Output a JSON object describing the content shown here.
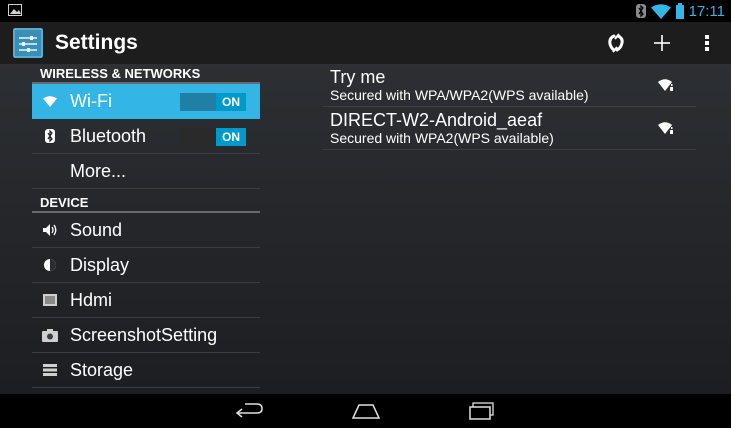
{
  "status_bar": {
    "time": "17:11",
    "icons": [
      "image-notification-icon",
      "bluetooth-icon",
      "wifi-icon",
      "battery-icon"
    ],
    "accent": "#33b5e5"
  },
  "action_bar": {
    "title": "Settings",
    "actions": [
      "wps-icon",
      "add-network-icon",
      "overflow-menu-icon"
    ]
  },
  "sections": {
    "wireless": {
      "header": "WIRELESS & NETWORKS",
      "items": [
        {
          "label": "Wi-Fi",
          "icon": "wifi-icon",
          "toggle": "ON",
          "selected": true
        },
        {
          "label": "Bluetooth",
          "icon": "bluetooth-icon",
          "toggle": "ON"
        },
        {
          "label": "More..."
        }
      ]
    },
    "device": {
      "header": "DEVICE",
      "items": [
        {
          "label": "Sound",
          "icon": "sound-icon"
        },
        {
          "label": "Display",
          "icon": "display-icon"
        },
        {
          "label": "Hdmi",
          "icon": "hdmi-icon"
        },
        {
          "label": "ScreenshotSetting",
          "icon": "camera-icon"
        },
        {
          "label": "Storage",
          "icon": "storage-icon"
        }
      ]
    }
  },
  "networks": [
    {
      "name": "Try me",
      "security": "Secured with WPA/WPA2(WPS available)",
      "icon": "wifi-signal-icon"
    },
    {
      "name": "DIRECT-W2-Android_aeaf",
      "security": "Secured with WPA2(WPS available)",
      "icon": "wifi-signal-icon"
    }
  ],
  "nav_bar": [
    "back-icon",
    "home-icon",
    "recents-icon"
  ],
  "colors": {
    "selected": "#33b5e5",
    "toggle_on": "#0099cc"
  }
}
